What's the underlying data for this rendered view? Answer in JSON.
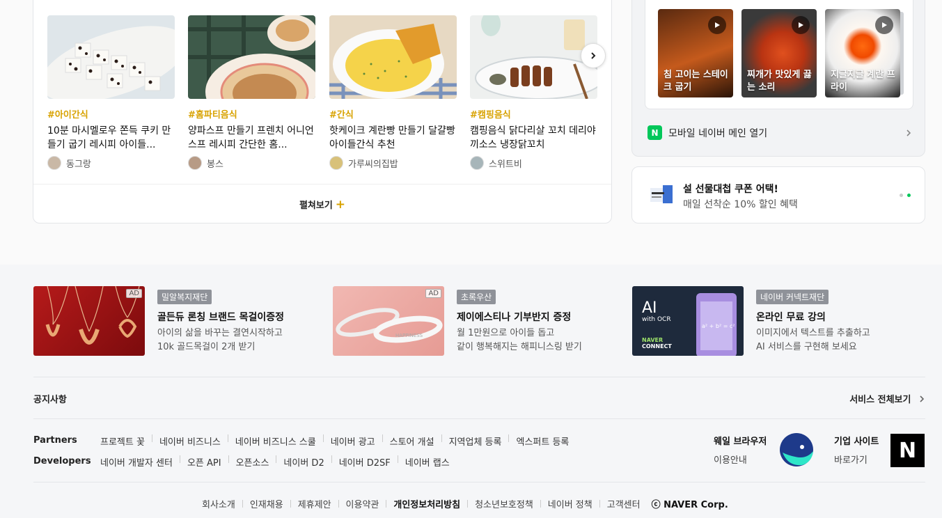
{
  "recipes": [
    {
      "tag": "#아이간식",
      "title": "10분 마시멜로우 쫀득 쿠키 만들기 굽기 레시피 아이들...",
      "author": "동그랑"
    },
    {
      "tag": "#홈파티음식",
      "title": "양파스프 만들기 프렌치 어니언스프 레시피 간단한 홈...",
      "author": "봉스"
    },
    {
      "tag": "#간식",
      "title": "핫케이크 계란빵 만들기 달걀빵 아이들간식 추천",
      "author": "가루씨의집밥"
    },
    {
      "tag": "#캠핑음식",
      "title": "캠핑음식 닭다리살 꼬치 데리야끼소스 냉장닭꼬치",
      "author": "스위트비"
    }
  ],
  "expand_label": "펼쳐보기",
  "videos": [
    {
      "label": "침 고이는 스테이크 굽기"
    },
    {
      "label": "찌개가 맛있게 끓는 소리"
    },
    {
      "label": "지글지글 계란 프라이"
    }
  ],
  "mobile_main": {
    "badge": "N",
    "label": "모바일 네이버 메인 열기"
  },
  "coupon": {
    "title": "설 선물대첩 쿠폰 어택!",
    "subtitle": "매일 선착순 10% 할인 혜택"
  },
  "ads": [
    {
      "mark": "AD",
      "badge": "밀알복지재단",
      "title": "골든듀 론칭 브랜드 목걸이증정",
      "desc1": "아이의 삶을 바꾸는 결연시작하고",
      "desc2": "10k 골드목걸이 2개 받기"
    },
    {
      "mark": "AD",
      "badge": "초록우산",
      "title": "제이에스티나 기부반지 증정",
      "desc1": "월 1만원으로 아이들 돕고",
      "desc2": "같이 행복해지는 해피니스링 받기",
      "ring_text": "HAPPINESS"
    },
    {
      "mark": "",
      "badge": "네이버 커넥트재단",
      "title": "온라인 무료 강의",
      "desc1": "이미지에서 텍스트를 추출하고",
      "desc2": "AI 서비스를 구현해 보세요",
      "img_big": "AI",
      "img_small": "with OCR",
      "img_brand1": "NAVER",
      "img_brand2": "CONNECT",
      "img_formula": "a² + b² = c²"
    }
  ],
  "notice": {
    "label": "공지사항",
    "service_all": "서비스 전체보기"
  },
  "partners": {
    "label": "Partners",
    "links": [
      "프로젝트 꽃",
      "네이버 비즈니스",
      "네이버 비즈니스 스쿨",
      "네이버 광고",
      "스토어 개설",
      "지역업체 등록",
      "엑스퍼트 등록"
    ]
  },
  "developers": {
    "label": "Developers",
    "links": [
      "네이버 개발자 센터",
      "오픈 API",
      "오픈소스",
      "네이버 D2",
      "네이버 D2SF",
      "네이버 랩스"
    ]
  },
  "whale": {
    "title": "웨일 브라우저",
    "sub": "이용안내"
  },
  "corp": {
    "title": "기업 사이트",
    "sub": "바로가기",
    "logo": "N"
  },
  "footer": {
    "links": [
      "회사소개",
      "인재채용",
      "제휴제안",
      "이용약관",
      "개인정보처리방침",
      "청소년보호정책",
      "네이버 정책",
      "고객센터"
    ],
    "copyright": "ⓒ NAVER Corp."
  },
  "colors": {
    "accent": "#d8a200",
    "naver_green": "#03c75a"
  }
}
